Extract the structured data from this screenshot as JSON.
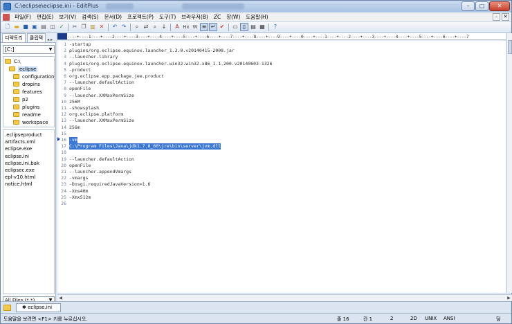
{
  "window": {
    "title": "C:\\eclipse\\eclipse.ini - EditPlus",
    "buttons": {
      "minimize": "–",
      "maximize": "□",
      "close": "✕"
    }
  },
  "menu": {
    "items": [
      "파일(F)",
      "편집(E)",
      "보기(V)",
      "검색(S)",
      "문서(D)",
      "프로젝트(P)",
      "도구(T)",
      "브라우저(B)",
      "ZC",
      "창(W)",
      "도움말(H)"
    ],
    "right_buttons": [
      "–",
      "✕"
    ]
  },
  "toolbar": {
    "icons": [
      "new-file",
      "open",
      "save",
      "save-all",
      "print",
      "print-preview",
      "spell-check",
      "cut",
      "copy",
      "paste",
      "delete",
      "undo",
      "redo",
      "find",
      "replace",
      "find-next",
      "go-to",
      "ruler",
      "heading",
      "toggle-line-numbers",
      "word-wrap",
      "spell",
      "fullscreen",
      "split",
      "panel",
      "cliptext",
      "browser",
      "help"
    ],
    "text_icons": {
      "hx": "Hx",
      "w": "W"
    }
  },
  "left_panel": {
    "tabs": {
      "directory": "디렉토리",
      "cliptext": "클립텍"
    },
    "tab_arrows": "◂ ▸",
    "drive": "[C:]",
    "tree": [
      {
        "label": "C:\\"
      },
      {
        "label": "eclipse",
        "selected": true
      },
      {
        "label": "configuration"
      },
      {
        "label": "dropins"
      },
      {
        "label": "features"
      },
      {
        "label": "p2"
      },
      {
        "label": "plugins"
      },
      {
        "label": "readme"
      },
      {
        "label": "workspace"
      }
    ],
    "files": [
      ".eclipseproduct",
      "artifacts.xml",
      "eclipse.exe",
      "eclipse.ini",
      "eclipse.ini.bak",
      "eclipsec.exe",
      "epl-v10.html",
      "notice.html"
    ],
    "filter": "All Files (*.*)"
  },
  "editor": {
    "ruler": "----+----1----+----2----+----3----+----4----+----5----+----6----+----7----+----8----+----9----+----0----+----1----+----2----+----3----+----4----+----5----+----6----+----7",
    "lines": [
      {
        "n": "1",
        "text": "-startup"
      },
      {
        "n": "2",
        "text": "plugins/org.eclipse.equinox.launcher_1.3.0.v20140415-2008.jar"
      },
      {
        "n": "3",
        "text": "--launcher.library"
      },
      {
        "n": "4",
        "text": "plugins/org.eclipse.equinox.launcher.win32.win32.x86_1.1.200.v20140603-1326"
      },
      {
        "n": "5",
        "text": "-product"
      },
      {
        "n": "6",
        "text": "org.eclipse.epp.package.jee.product"
      },
      {
        "n": "7",
        "text": "--launcher.defaultAction"
      },
      {
        "n": "8",
        "text": "openFile"
      },
      {
        "n": "9",
        "text": "--launcher.XXMaxPermSize"
      },
      {
        "n": "10",
        "text": "256M"
      },
      {
        "n": "11",
        "text": "-showsplash"
      },
      {
        "n": "12",
        "text": "org.eclipse.platform"
      },
      {
        "n": "13",
        "text": "--launcher.XXMaxPermSize"
      },
      {
        "n": "14",
        "text": "256m"
      },
      {
        "n": "15",
        "text": ""
      },
      {
        "n": "16",
        "text": "-vm",
        "selected": true
      },
      {
        "n": "17",
        "text": "C:\\Program Files\\Java\\jdk1.7.0_60\\jre\\bin\\server\\jvm.dll",
        "selected": true
      },
      {
        "n": "18",
        "text": ""
      },
      {
        "n": "19",
        "text": "--launcher.defaultAction"
      },
      {
        "n": "20",
        "text": "openFile"
      },
      {
        "n": "21",
        "text": "--launcher.appendVmargs"
      },
      {
        "n": "22",
        "text": "-vmargs"
      },
      {
        "n": "23",
        "text": "-Dosgi.requiredJavaVersion=1.6"
      },
      {
        "n": "24",
        "text": "-Xms40m"
      },
      {
        "n": "25",
        "text": "-Xmx512m"
      },
      {
        "n": "26",
        "text": ""
      }
    ]
  },
  "doc_tab": {
    "label": "✱ eclipse.ini"
  },
  "status": {
    "help": "도움말을 보려면 <F1> 키를 누르십시오.",
    "line": "줄 16",
    "col": "칸 1",
    "sel": "2",
    "col2": "2D",
    "eol": "UNIX",
    "encoding": "ANSI",
    "mode": "덮"
  }
}
